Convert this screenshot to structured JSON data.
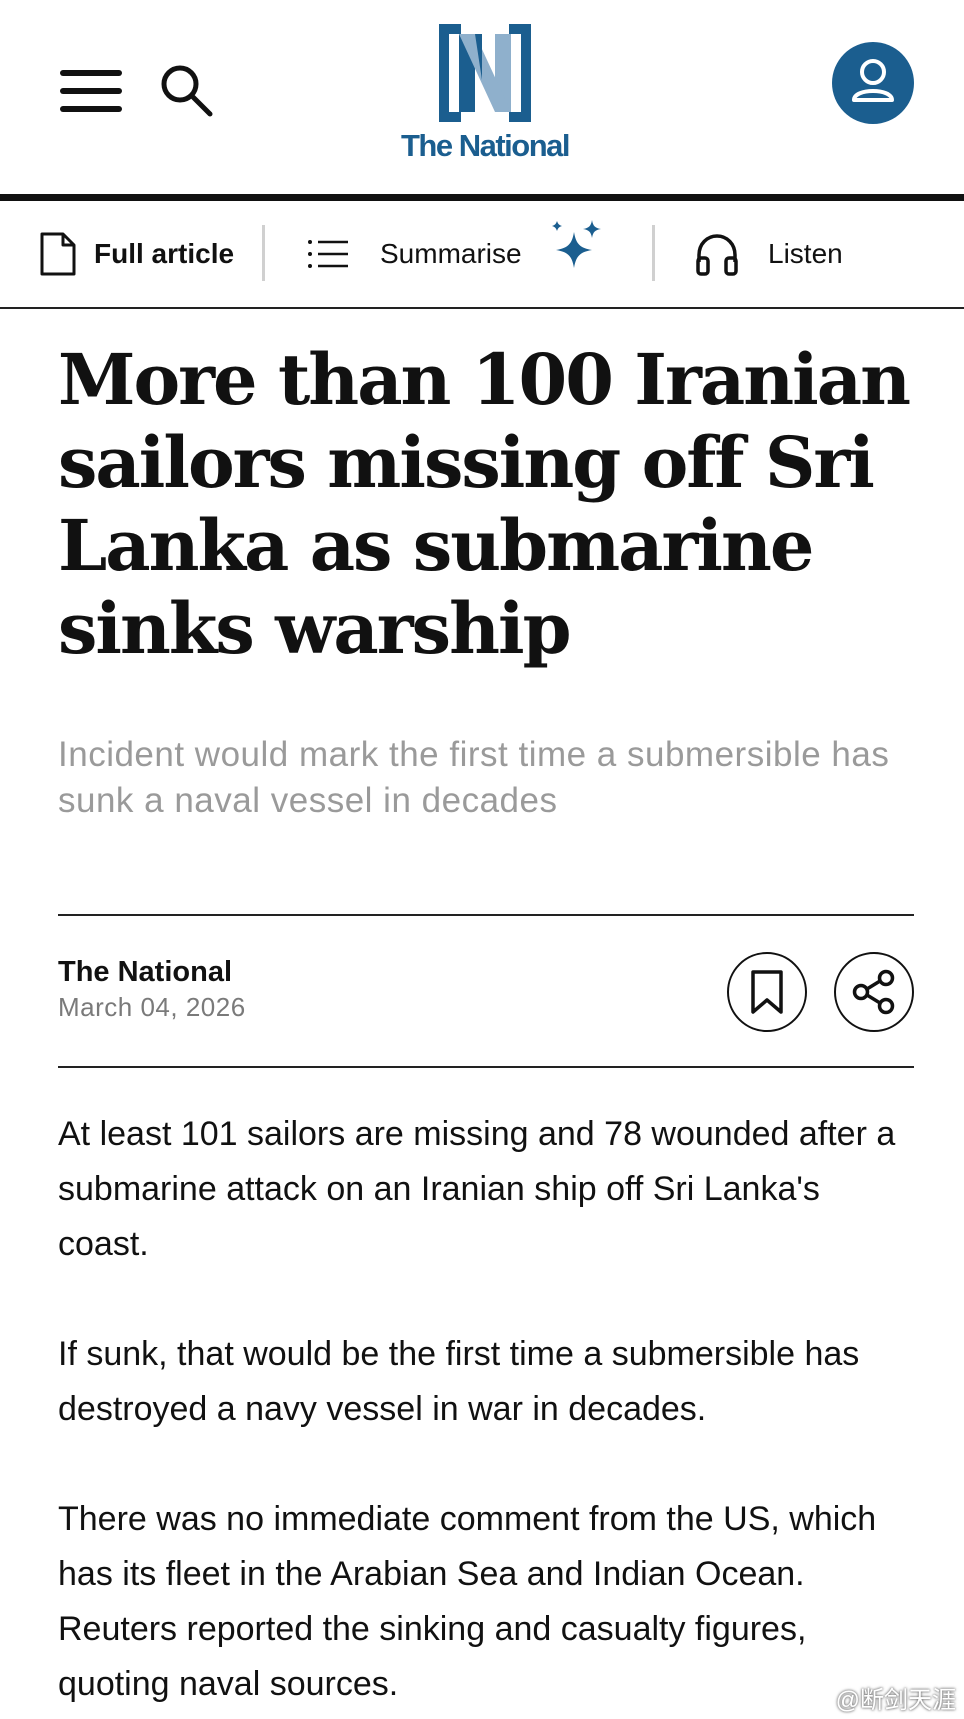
{
  "header": {
    "brand": "The National",
    "brand_color": "#1b5e8f",
    "icons": [
      "menu-icon",
      "search-icon",
      "user-icon"
    ]
  },
  "toolbar": {
    "full_article": "Full article",
    "summarise": "Summarise",
    "listen": "Listen",
    "icons": [
      "document-icon",
      "list-icon",
      "sparkle-icon",
      "headphones-icon"
    ]
  },
  "article": {
    "headline": "More than 100 Iranian sailors missing off Sri Lanka as submarine sinks warship",
    "subheadline": "Incident would mark the first time a submersible has sunk a naval vessel in decades",
    "author": "The National",
    "date": "March 04, 2026",
    "actions": [
      "bookmark-icon",
      "share-icon"
    ],
    "paragraphs": [
      "At least 101 sailors are missing and 78 wounded after a submarine attack on an Iranian ship off Sri Lanka's coast.",
      "If sunk, that would be the first time a submersible has destroyed a navy vessel in war in decades.",
      "There was no immediate comment from the US, which has its fleet in the Arabian Sea and Indian Ocean. Reuters reported the sinking and casualty figures, quoting naval sources."
    ]
  },
  "watermark": "@断剑天涯"
}
